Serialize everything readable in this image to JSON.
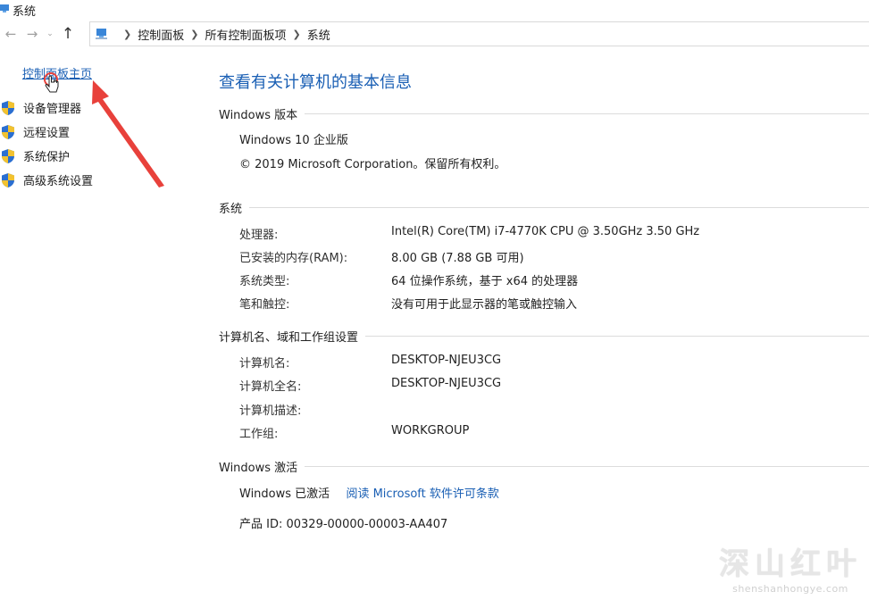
{
  "window": {
    "title": "系统"
  },
  "address_bar": {
    "breadcrumbs": [
      "控制面板",
      "所有控制面板项",
      "系统"
    ]
  },
  "sidebar": {
    "home_link": "控制面板主页",
    "items": [
      {
        "label": "设备管理器",
        "icon": "uac-shield-icon"
      },
      {
        "label": "远程设置",
        "icon": "uac-shield-icon"
      },
      {
        "label": "系统保护",
        "icon": "uac-shield-icon"
      },
      {
        "label": "高级系统设置",
        "icon": "uac-shield-icon"
      }
    ]
  },
  "main": {
    "title": "查看有关计算机的基本信息",
    "windows_edition": {
      "heading": "Windows 版本",
      "edition": "Windows 10 企业版",
      "copyright": "© 2019 Microsoft Corporation。保留所有权利。"
    },
    "system": {
      "heading": "系统",
      "rows": [
        {
          "label": "处理器:",
          "value": "Intel(R) Core(TM) i7-4770K CPU @ 3.50GHz   3.50 GHz"
        },
        {
          "label": "已安装的内存(RAM):",
          "value": "8.00 GB (7.88 GB 可用)"
        },
        {
          "label": "系统类型:",
          "value": "64 位操作系统，基于 x64 的处理器"
        },
        {
          "label": "笔和触控:",
          "value": "没有可用于此显示器的笔或触控输入"
        }
      ]
    },
    "computer_name": {
      "heading": "计算机名、域和工作组设置",
      "rows": [
        {
          "label": "计算机名:",
          "value": "DESKTOP-NJEU3CG"
        },
        {
          "label": "计算机全名:",
          "value": "DESKTOP-NJEU3CG"
        },
        {
          "label": "计算机描述:",
          "value": ""
        },
        {
          "label": "工作组:",
          "value": "WORKGROUP"
        }
      ]
    },
    "activation": {
      "heading": "Windows 激活",
      "status": "Windows 已激活",
      "license_link": "阅读 Microsoft 软件许可条款",
      "product_id": "产品 ID: 00329-00000-00003-AA407"
    }
  },
  "watermark": {
    "main": "深山红叶",
    "sub": "shenshanhongye.com"
  },
  "colors": {
    "link": "#1a5fb4",
    "annotation_arrow": "#e8413b",
    "shield_blue": "#2b6fd1",
    "shield_yellow": "#f2c230"
  }
}
